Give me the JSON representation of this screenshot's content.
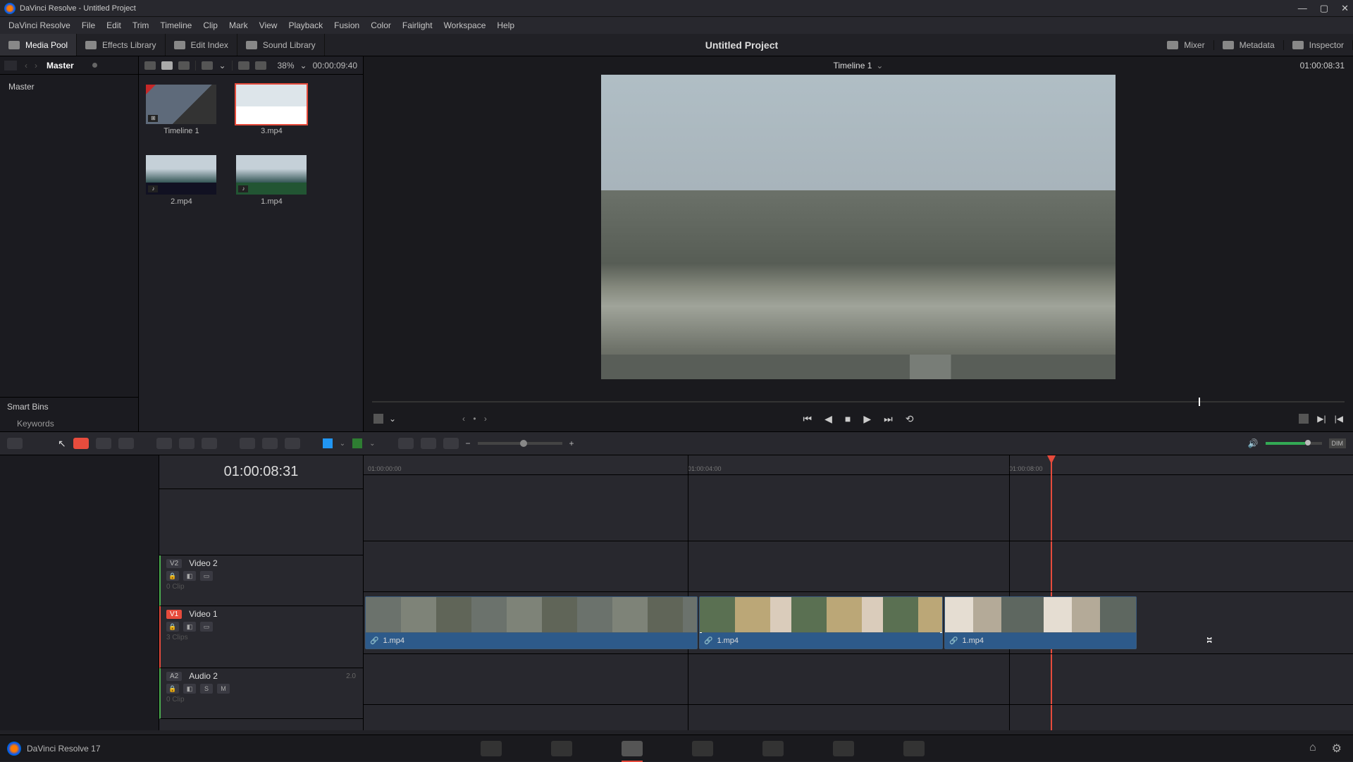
{
  "titlebar": {
    "text": "DaVinci Resolve - Untitled Project"
  },
  "menus": [
    "DaVinci Resolve",
    "File",
    "Edit",
    "Trim",
    "Timeline",
    "Clip",
    "Mark",
    "View",
    "Playback",
    "Fusion",
    "Color",
    "Fairlight",
    "Workspace",
    "Help"
  ],
  "workspace": {
    "media_pool": "Media Pool",
    "effects": "Effects Library",
    "edit_index": "Edit Index",
    "sound": "Sound Library",
    "project": "Untitled Project",
    "mixer": "Mixer",
    "metadata": "Metadata",
    "inspector": "Inspector"
  },
  "mediapool": {
    "master": "Master",
    "zoom": "38%",
    "tc": "00:00:09:40",
    "thumbs": [
      {
        "name": "Timeline 1",
        "badge": "⊞"
      },
      {
        "name": "3.mp4",
        "badge": ""
      },
      {
        "name": "2.mp4",
        "badge": "♪"
      },
      {
        "name": "1.mp4",
        "badge": "♪"
      }
    ],
    "smart_bins": "Smart Bins",
    "keywords": "Keywords"
  },
  "viewer": {
    "name": "Timeline 1",
    "tc": "01:00:08:31"
  },
  "timeline": {
    "tc": "01:00:08:31",
    "ruler": [
      "01:00:00:00",
      "01:00:04:00",
      "01:00:08:00"
    ],
    "tracks": {
      "v2": {
        "tag": "V2",
        "name": "Video 2",
        "sub": "0 Clip"
      },
      "v1": {
        "tag": "V1",
        "name": "Video 1",
        "sub": "3 Clips"
      },
      "a2": {
        "tag": "A2",
        "name": "Audio 2",
        "meta": "2.0",
        "sub": "0 Clip",
        "s": "S",
        "m": "M"
      }
    },
    "clips": [
      {
        "name": "1.mp4"
      },
      {
        "name": "1.mp4"
      },
      {
        "name": "1.mp4"
      }
    ]
  },
  "toolbar": {
    "dim": "DIM"
  },
  "footer": {
    "version": "DaVinci Resolve 17"
  }
}
